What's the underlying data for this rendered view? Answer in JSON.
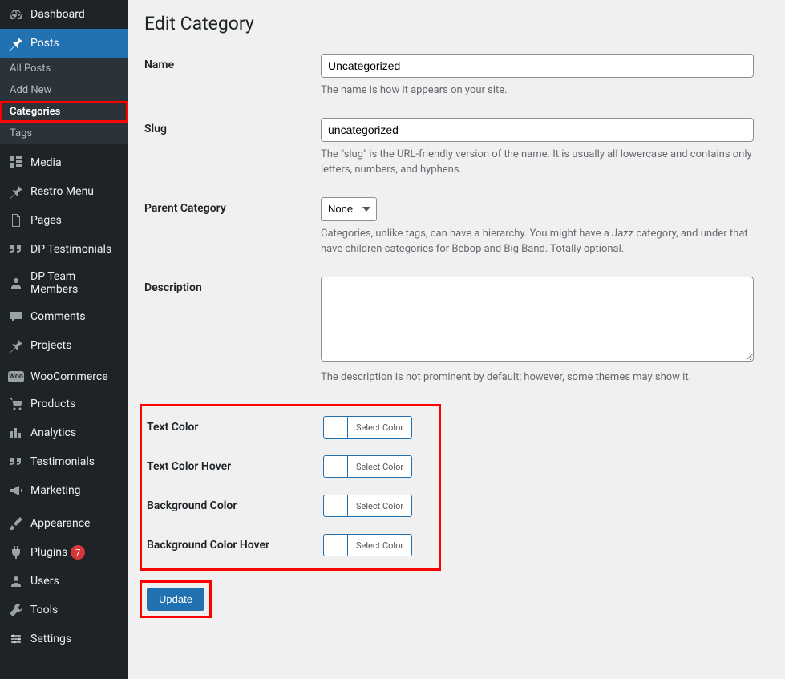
{
  "sidebar": {
    "items": [
      {
        "label": "Dashboard"
      },
      {
        "label": "Posts"
      },
      {
        "label": "Media"
      },
      {
        "label": "Restro Menu"
      },
      {
        "label": "Pages"
      },
      {
        "label": "DP Testimonials"
      },
      {
        "label": "DP Team Members"
      },
      {
        "label": "Comments"
      },
      {
        "label": "Projects"
      },
      {
        "label": "WooCommerce"
      },
      {
        "label": "Products"
      },
      {
        "label": "Analytics"
      },
      {
        "label": "Testimonials"
      },
      {
        "label": "Marketing"
      },
      {
        "label": "Appearance"
      },
      {
        "label": "Plugins",
        "badge": "7"
      },
      {
        "label": "Users"
      },
      {
        "label": "Tools"
      },
      {
        "label": "Settings"
      }
    ],
    "submenu": {
      "allPosts": "All Posts",
      "addNew": "Add New",
      "categories": "Categories",
      "tags": "Tags"
    }
  },
  "page": {
    "title": "Edit Category",
    "fields": {
      "name": {
        "label": "Name",
        "value": "Uncategorized",
        "desc": "The name is how it appears on your site."
      },
      "slug": {
        "label": "Slug",
        "value": "uncategorized",
        "desc": "The \"slug\" is the URL-friendly version of the name. It is usually all lowercase and contains only letters, numbers, and hyphens."
      },
      "parent": {
        "label": "Parent Category",
        "value": "None",
        "desc": "Categories, unlike tags, can have a hierarchy. You might have a Jazz category, and under that have children categories for Bebop and Big Band. Totally optional."
      },
      "description": {
        "label": "Description",
        "value": "",
        "desc": "The description is not prominent by default; however, some themes may show it."
      },
      "textColor": {
        "label": "Text Color",
        "button": "Select Color"
      },
      "textColorHover": {
        "label": "Text Color Hover",
        "button": "Select Color"
      },
      "bgColor": {
        "label": "Background Color",
        "button": "Select Color"
      },
      "bgColorHover": {
        "label": "Background Color Hover",
        "button": "Select Color"
      }
    },
    "updateButton": "Update"
  }
}
